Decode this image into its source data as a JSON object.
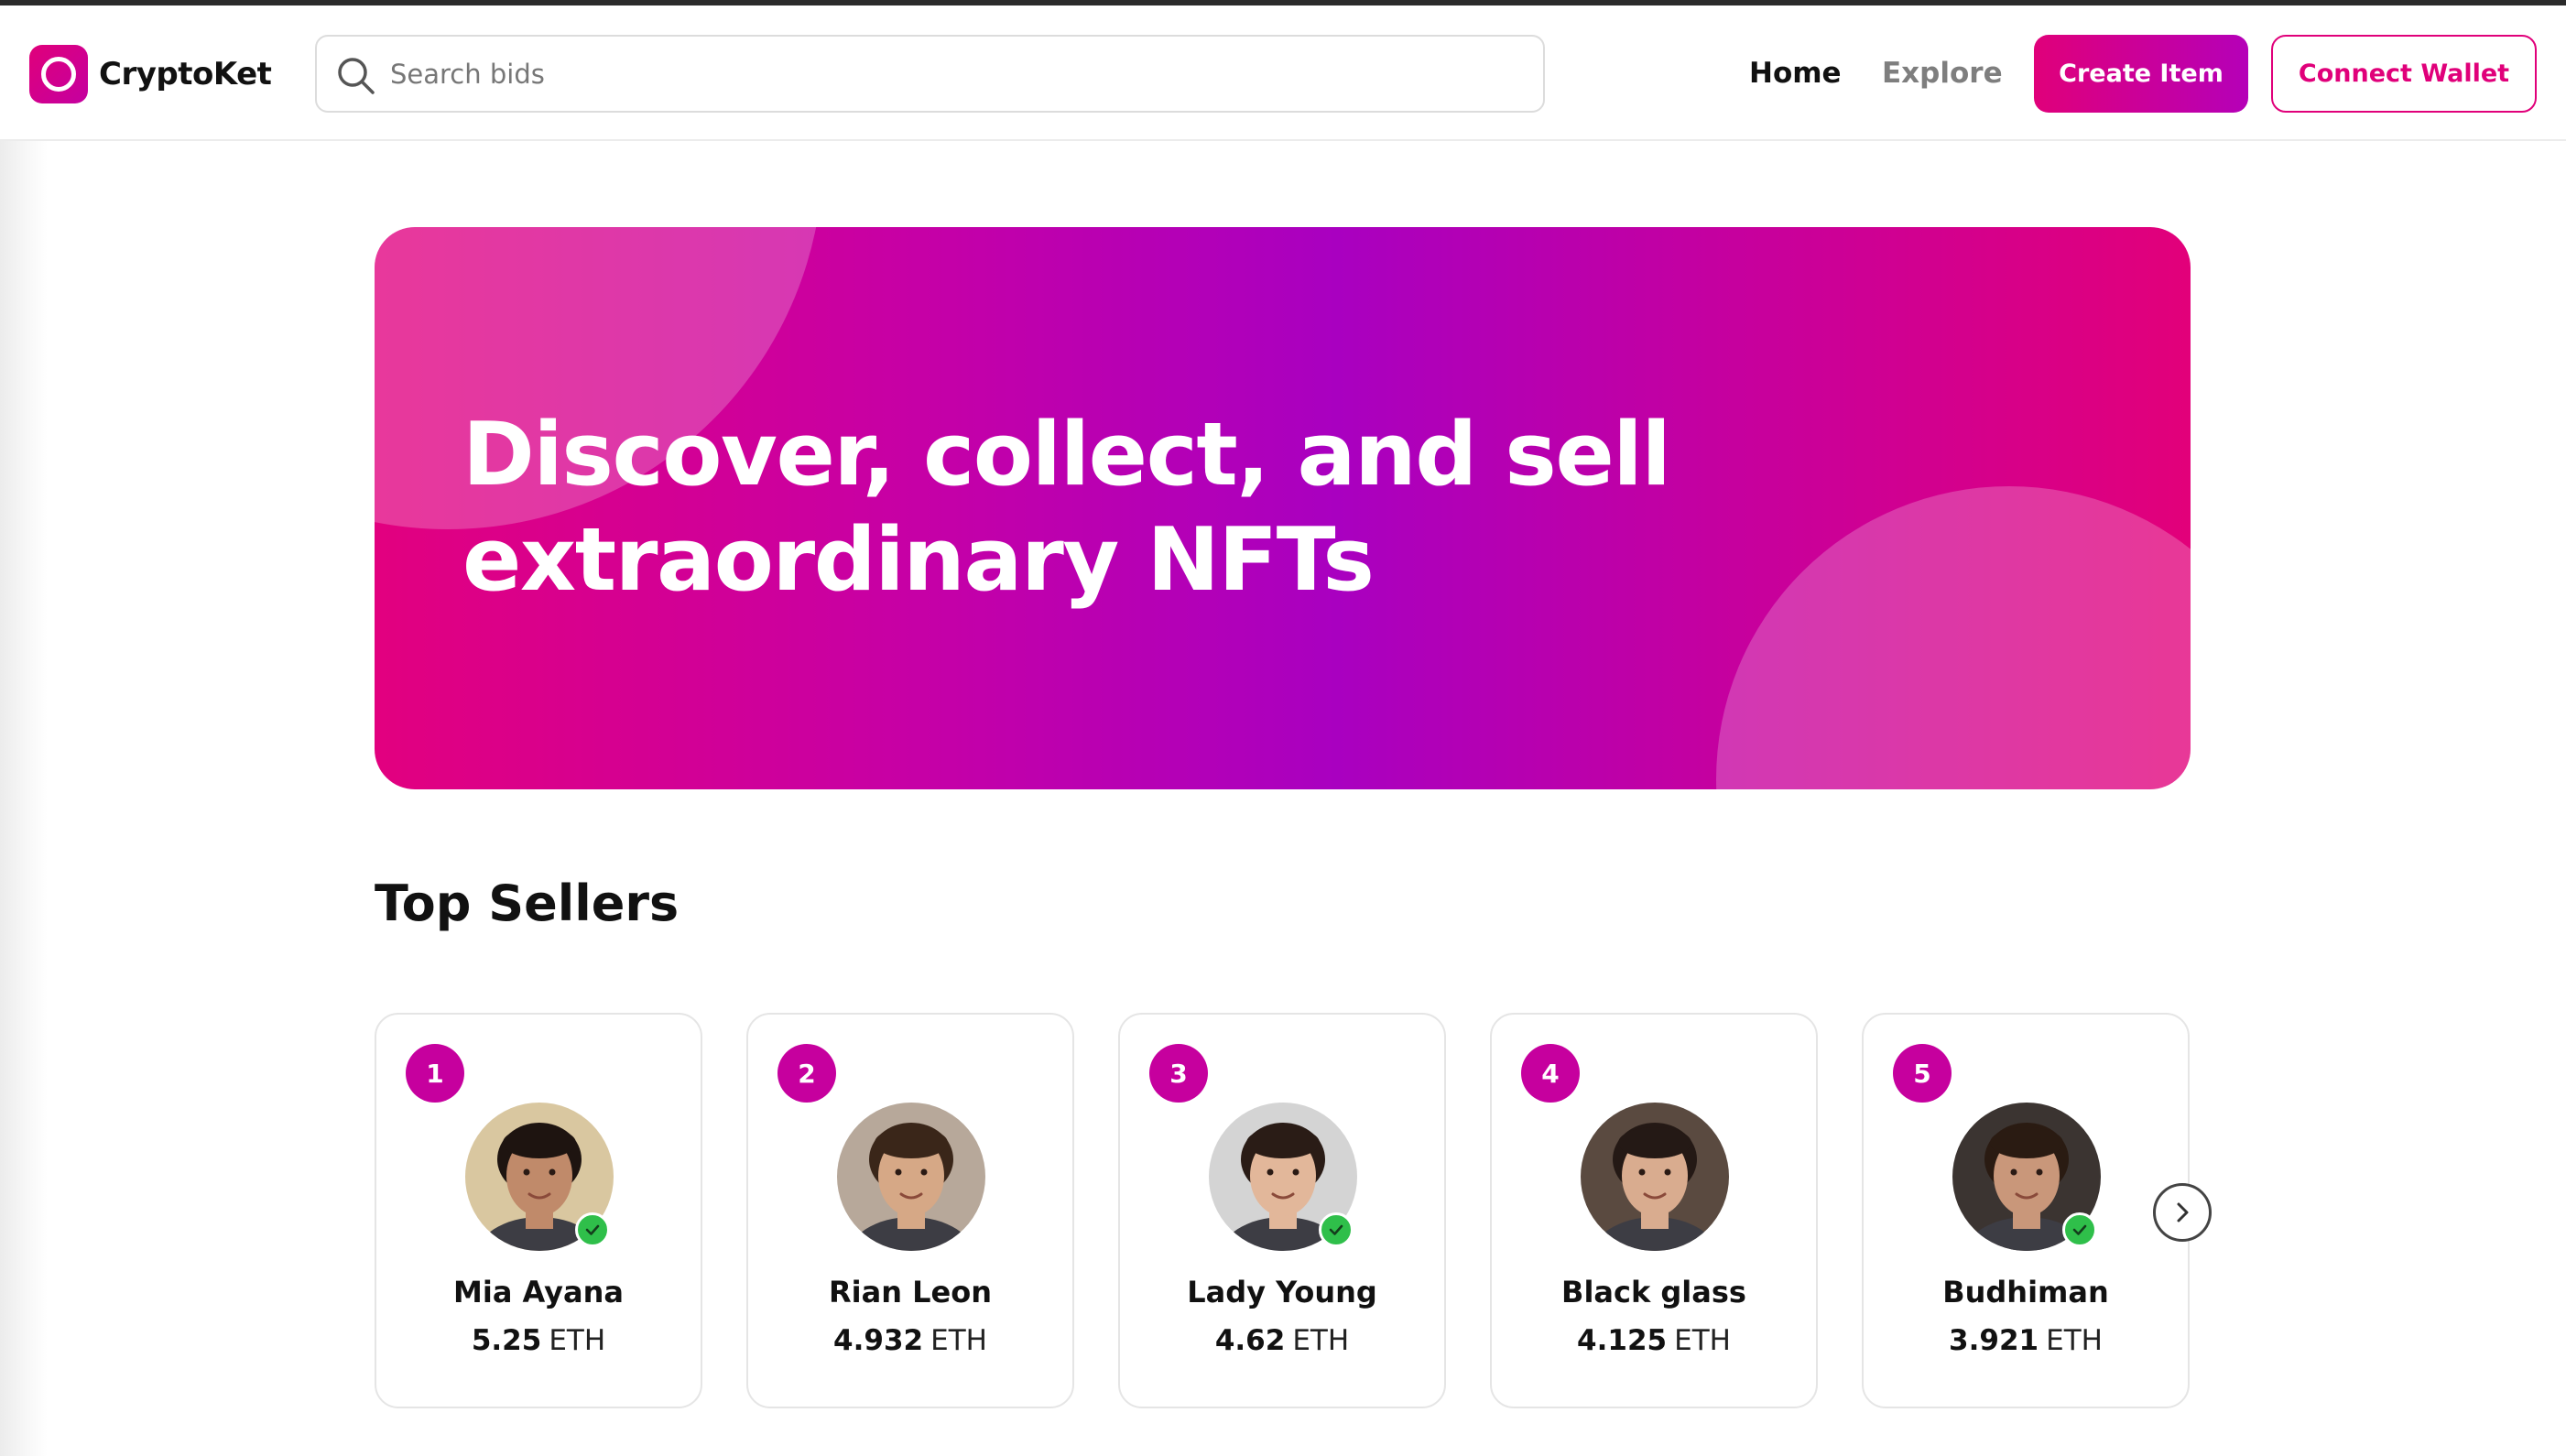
{
  "brand": {
    "name": "CryptoKet",
    "accent": "#e0007a",
    "accent_purple": "#b500b8"
  },
  "header": {
    "search_placeholder": "Search bids",
    "search_value": "",
    "nav": {
      "home_label": "Home",
      "explore_label": "Explore"
    },
    "create_label": "Create Item",
    "wallet_label": "Connect Wallet"
  },
  "hero": {
    "line1": "Discover, collect, and sell",
    "line2": "extraordinary NFTs"
  },
  "top_sellers": {
    "title": "Top Sellers",
    "unit": "ETH",
    "sellers": [
      {
        "rank": "1",
        "name": "Mia Ayana",
        "amount": "5.25",
        "verified": true,
        "skin": "#c08a6a",
        "hair": "#1e1410",
        "bg": "#d9c7a0"
      },
      {
        "rank": "2",
        "name": "Rian Leon",
        "amount": "4.932",
        "verified": false,
        "skin": "#d6a886",
        "hair": "#3a2619",
        "bg": "#b7a89a"
      },
      {
        "rank": "3",
        "name": "Lady Young",
        "amount": "4.62",
        "verified": true,
        "skin": "#e2b79a",
        "hair": "#2a1c16",
        "bg": "#d4d4d4"
      },
      {
        "rank": "4",
        "name": "Black glass",
        "amount": "4.125",
        "verified": false,
        "skin": "#d9ac8f",
        "hair": "#241915",
        "bg": "#5a4a40"
      },
      {
        "rank": "5",
        "name": "Budhiman",
        "amount": "3.921",
        "verified": true,
        "skin": "#c9977a",
        "hair": "#2a1b12",
        "bg": "#3b3431"
      }
    ]
  },
  "icons": {
    "search": "search-icon",
    "next": "chevron-right-icon",
    "verified": "check-icon"
  }
}
